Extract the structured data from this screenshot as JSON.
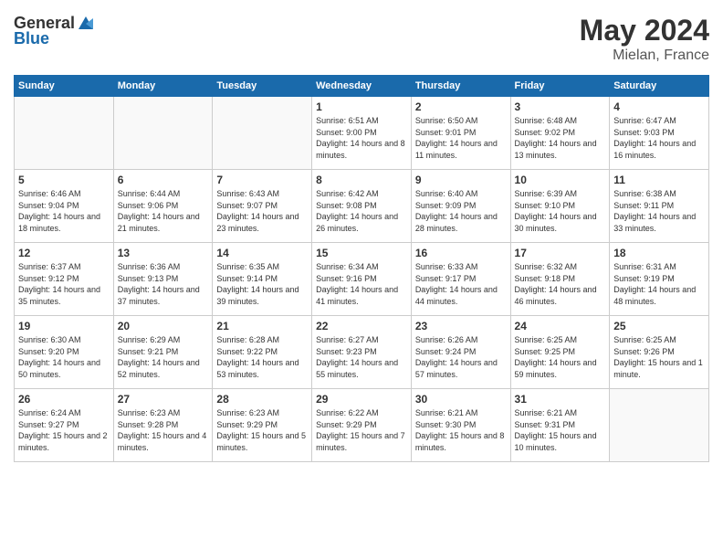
{
  "header": {
    "logo_general": "General",
    "logo_blue": "Blue",
    "month": "May 2024",
    "location": "Mielan, France"
  },
  "weekdays": [
    "Sunday",
    "Monday",
    "Tuesday",
    "Wednesday",
    "Thursday",
    "Friday",
    "Saturday"
  ],
  "weeks": [
    [
      {
        "day": "",
        "info": ""
      },
      {
        "day": "",
        "info": ""
      },
      {
        "day": "",
        "info": ""
      },
      {
        "day": "1",
        "info": "Sunrise: 6:51 AM\nSunset: 9:00 PM\nDaylight: 14 hours and 8 minutes."
      },
      {
        "day": "2",
        "info": "Sunrise: 6:50 AM\nSunset: 9:01 PM\nDaylight: 14 hours and 11 minutes."
      },
      {
        "day": "3",
        "info": "Sunrise: 6:48 AM\nSunset: 9:02 PM\nDaylight: 14 hours and 13 minutes."
      },
      {
        "day": "4",
        "info": "Sunrise: 6:47 AM\nSunset: 9:03 PM\nDaylight: 14 hours and 16 minutes."
      }
    ],
    [
      {
        "day": "5",
        "info": "Sunrise: 6:46 AM\nSunset: 9:04 PM\nDaylight: 14 hours and 18 minutes."
      },
      {
        "day": "6",
        "info": "Sunrise: 6:44 AM\nSunset: 9:06 PM\nDaylight: 14 hours and 21 minutes."
      },
      {
        "day": "7",
        "info": "Sunrise: 6:43 AM\nSunset: 9:07 PM\nDaylight: 14 hours and 23 minutes."
      },
      {
        "day": "8",
        "info": "Sunrise: 6:42 AM\nSunset: 9:08 PM\nDaylight: 14 hours and 26 minutes."
      },
      {
        "day": "9",
        "info": "Sunrise: 6:40 AM\nSunset: 9:09 PM\nDaylight: 14 hours and 28 minutes."
      },
      {
        "day": "10",
        "info": "Sunrise: 6:39 AM\nSunset: 9:10 PM\nDaylight: 14 hours and 30 minutes."
      },
      {
        "day": "11",
        "info": "Sunrise: 6:38 AM\nSunset: 9:11 PM\nDaylight: 14 hours and 33 minutes."
      }
    ],
    [
      {
        "day": "12",
        "info": "Sunrise: 6:37 AM\nSunset: 9:12 PM\nDaylight: 14 hours and 35 minutes."
      },
      {
        "day": "13",
        "info": "Sunrise: 6:36 AM\nSunset: 9:13 PM\nDaylight: 14 hours and 37 minutes."
      },
      {
        "day": "14",
        "info": "Sunrise: 6:35 AM\nSunset: 9:14 PM\nDaylight: 14 hours and 39 minutes."
      },
      {
        "day": "15",
        "info": "Sunrise: 6:34 AM\nSunset: 9:16 PM\nDaylight: 14 hours and 41 minutes."
      },
      {
        "day": "16",
        "info": "Sunrise: 6:33 AM\nSunset: 9:17 PM\nDaylight: 14 hours and 44 minutes."
      },
      {
        "day": "17",
        "info": "Sunrise: 6:32 AM\nSunset: 9:18 PM\nDaylight: 14 hours and 46 minutes."
      },
      {
        "day": "18",
        "info": "Sunrise: 6:31 AM\nSunset: 9:19 PM\nDaylight: 14 hours and 48 minutes."
      }
    ],
    [
      {
        "day": "19",
        "info": "Sunrise: 6:30 AM\nSunset: 9:20 PM\nDaylight: 14 hours and 50 minutes."
      },
      {
        "day": "20",
        "info": "Sunrise: 6:29 AM\nSunset: 9:21 PM\nDaylight: 14 hours and 52 minutes."
      },
      {
        "day": "21",
        "info": "Sunrise: 6:28 AM\nSunset: 9:22 PM\nDaylight: 14 hours and 53 minutes."
      },
      {
        "day": "22",
        "info": "Sunrise: 6:27 AM\nSunset: 9:23 PM\nDaylight: 14 hours and 55 minutes."
      },
      {
        "day": "23",
        "info": "Sunrise: 6:26 AM\nSunset: 9:24 PM\nDaylight: 14 hours and 57 minutes."
      },
      {
        "day": "24",
        "info": "Sunrise: 6:25 AM\nSunset: 9:25 PM\nDaylight: 14 hours and 59 minutes."
      },
      {
        "day": "25",
        "info": "Sunrise: 6:25 AM\nSunset: 9:26 PM\nDaylight: 15 hours and 1 minute."
      }
    ],
    [
      {
        "day": "26",
        "info": "Sunrise: 6:24 AM\nSunset: 9:27 PM\nDaylight: 15 hours and 2 minutes."
      },
      {
        "day": "27",
        "info": "Sunrise: 6:23 AM\nSunset: 9:28 PM\nDaylight: 15 hours and 4 minutes."
      },
      {
        "day": "28",
        "info": "Sunrise: 6:23 AM\nSunset: 9:29 PM\nDaylight: 15 hours and 5 minutes."
      },
      {
        "day": "29",
        "info": "Sunrise: 6:22 AM\nSunset: 9:29 PM\nDaylight: 15 hours and 7 minutes."
      },
      {
        "day": "30",
        "info": "Sunrise: 6:21 AM\nSunset: 9:30 PM\nDaylight: 15 hours and 8 minutes."
      },
      {
        "day": "31",
        "info": "Sunrise: 6:21 AM\nSunset: 9:31 PM\nDaylight: 15 hours and 10 minutes."
      },
      {
        "day": "",
        "info": ""
      }
    ]
  ]
}
